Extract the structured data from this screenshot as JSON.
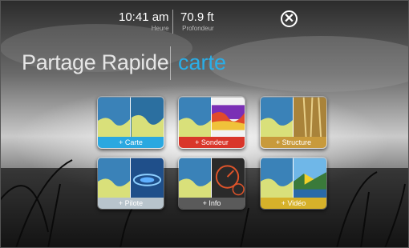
{
  "status": {
    "time": "10:41 am",
    "time_label": "Heure",
    "depth": "70.9 ft",
    "depth_label": "Profondeur"
  },
  "header": {
    "title": "Partage Rapide",
    "subtitle": "carte"
  },
  "close_icon": "✕",
  "tiles": [
    {
      "label": "+ Carte",
      "color": "#2aa8e0"
    },
    {
      "label": "+ Sondeur",
      "color": "#d9362a"
    },
    {
      "label": "+ Structure",
      "color": "#c89a3c"
    },
    {
      "label": "+ Pilote",
      "color": "#b8c4cc"
    },
    {
      "label": "+ Info",
      "color": "#5a5a5a"
    },
    {
      "label": "+ Vidéo",
      "color": "#d6b12a"
    }
  ]
}
